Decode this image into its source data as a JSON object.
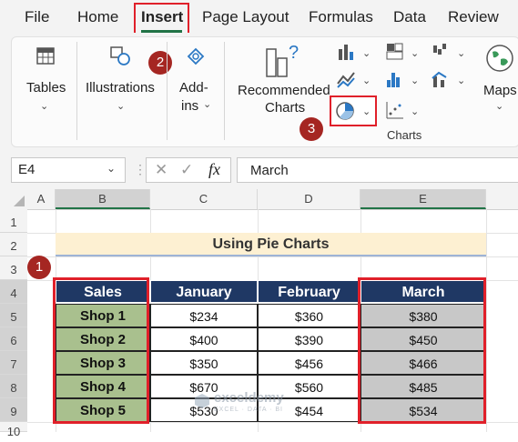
{
  "menu": [
    "File",
    "Home",
    "Insert",
    "Page Layout",
    "Formulas",
    "Data",
    "Review"
  ],
  "ribbon": {
    "tables": "Tables",
    "illustrations": "Illustrations",
    "addins_1": "Add-",
    "addins_2": "ins",
    "recommended_1": "Recommended",
    "recommended_2": "Charts",
    "maps": "Maps",
    "charts_group": "Charts"
  },
  "badges": [
    "1",
    "2",
    "3"
  ],
  "formula_bar": {
    "name_box": "E4",
    "fx": "fx",
    "formula": "March"
  },
  "columns": [
    "A",
    "B",
    "C",
    "D",
    "E"
  ],
  "rows": [
    "1",
    "2",
    "3",
    "4",
    "5",
    "6",
    "7",
    "8",
    "9",
    "10"
  ],
  "sheet": {
    "title": "Using Pie Charts",
    "headers": [
      "Sales",
      "January",
      "February",
      "March"
    ],
    "data": [
      [
        "Shop 1",
        "$234",
        "$360",
        "$380"
      ],
      [
        "Shop 2",
        "$400",
        "$390",
        "$450"
      ],
      [
        "Shop 3",
        "$350",
        "$456",
        "$466"
      ],
      [
        "Shop 4",
        "$670",
        "$560",
        "$485"
      ],
      [
        "Shop 5",
        "$530",
        "$454",
        "$534"
      ]
    ]
  },
  "watermark": {
    "brand": "exceldemy",
    "tagline": "EXCEL · DATA · BI"
  },
  "colors": {
    "header_bg": "#1f3864",
    "shop_bg": "#a9c08e",
    "march_bg": "#c8c8c8",
    "highlight": "#e0202a",
    "title_bg": "#fdf0d2"
  }
}
